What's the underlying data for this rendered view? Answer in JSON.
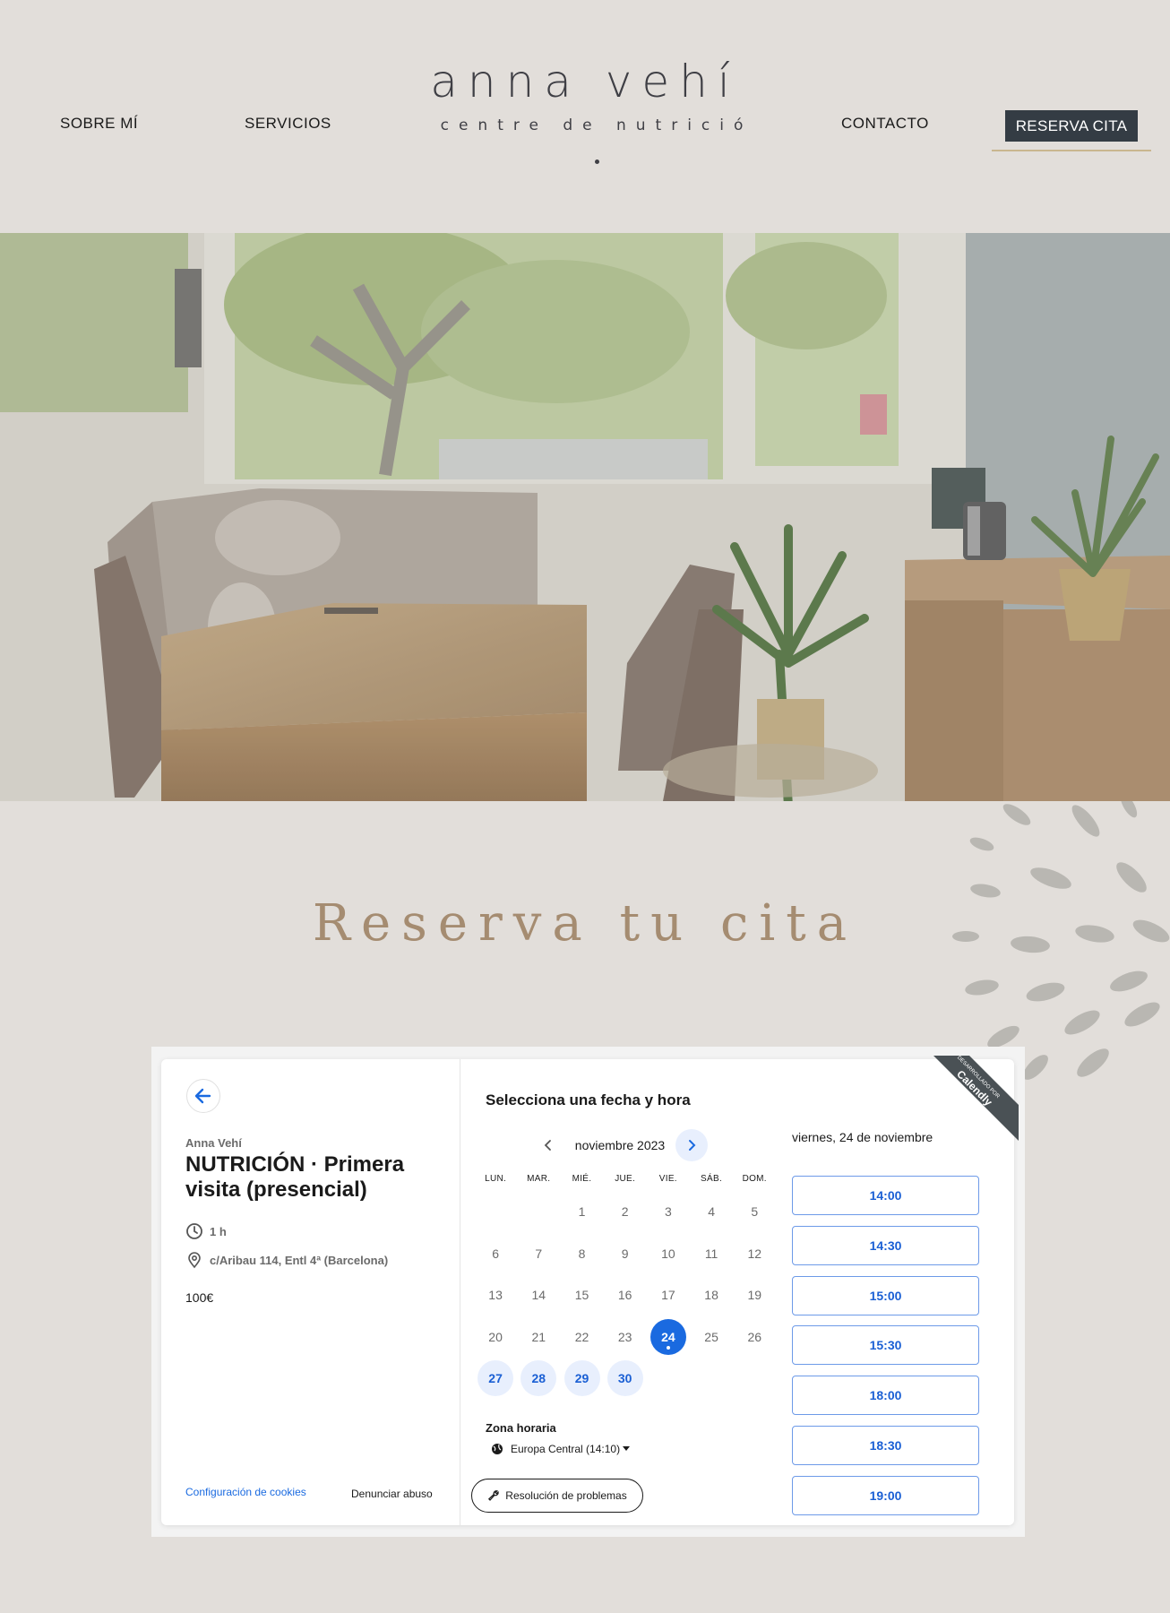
{
  "header": {
    "nav_left": [
      "SOBRE MÍ",
      "SERVICIOS"
    ],
    "nav_right": "CONTACTO",
    "logo_title": "anna vehí",
    "logo_subtitle": "centre de nutrició",
    "cta_label": "RESERVA CITA"
  },
  "section": {
    "title": "Reserva tu cita"
  },
  "widget": {
    "organizer": "Anna Vehí",
    "event_name": "NUTRICIÓN · Primera visita (presencial)",
    "duration": "1 h",
    "location": "c/Aribau 114, Entl 4ª (Barcelona)",
    "price": "100€",
    "cookies_link": "Configuración de cookies",
    "abuse_link": "Denunciar abuso",
    "pick_title": "Selecciona una fecha y hora",
    "month": "noviembre 2023",
    "weekdays": [
      "LUN.",
      "MAR.",
      "MIÉ.",
      "JUE.",
      "VIE.",
      "SÁB.",
      "DOM."
    ],
    "days": [
      "1",
      "2",
      "3",
      "4",
      "5",
      "6",
      "7",
      "8",
      "9",
      "10",
      "11",
      "12",
      "13",
      "14",
      "15",
      "16",
      "17",
      "18",
      "19",
      "20",
      "21",
      "22",
      "23",
      "24",
      "25",
      "26",
      "27",
      "28",
      "29",
      "30"
    ],
    "first_weekday_index": 2,
    "selected_day": "24",
    "available_days": [
      "24",
      "27",
      "28",
      "29",
      "30"
    ],
    "timezone_label": "Zona horaria",
    "timezone_value": "Europa Central (14:10)",
    "troubleshoot": "Resolución de problemas",
    "selected_date_label": "viernes, 24 de noviembre",
    "time_slots": [
      "14:00",
      "14:30",
      "15:00",
      "15:30",
      "18:00",
      "18:30",
      "19:00"
    ],
    "ribbon_small": "DESARROLLADO POR",
    "ribbon_brand": "Calendly"
  },
  "colors": {
    "background": "#e2deda",
    "cta": "#343c44",
    "accent_gold": "#c9b68f",
    "title_tan": "#a58c71",
    "calendly_blue": "#1a6ae0"
  }
}
